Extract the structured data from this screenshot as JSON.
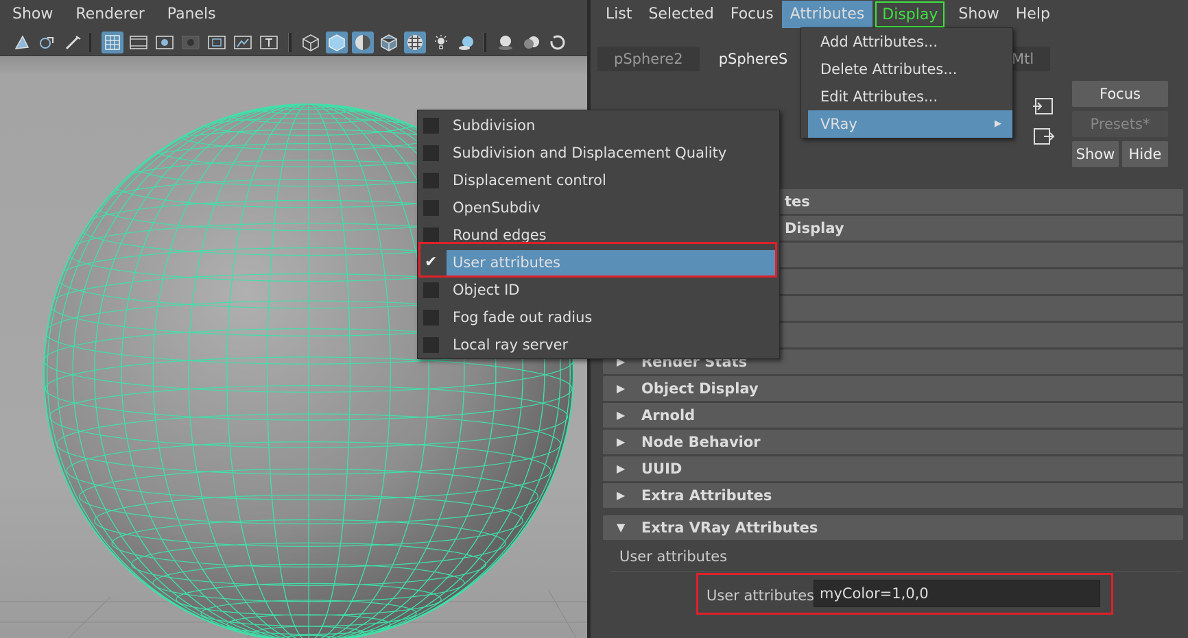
{
  "viewport": {
    "menu": [
      "Show",
      "Renderer",
      "Panels"
    ]
  },
  "attribute_editor": {
    "menu": [
      "List",
      "Selected",
      "Focus",
      "Attributes",
      "Display",
      "Show",
      "Help"
    ],
    "tabs": [
      "pSphere2",
      "pSphereS",
      "Mtl"
    ],
    "buttons": {
      "focus": "Focus",
      "presets": "Presets*",
      "show": "Show",
      "hide": "Hide"
    },
    "partial_sections": [
      "tes",
      "Display"
    ],
    "sections": [
      "Render Stats",
      "Object Display",
      "Arnold",
      "Node Behavior",
      "UUID",
      "Extra Attributes"
    ],
    "open_section": "Extra VRay Attributes",
    "user_attributes_group": "User attributes",
    "user_attributes_field_label": "User attributes",
    "user_attributes_value": "myColor=1,0,0"
  },
  "attributes_menu": {
    "items": [
      "Add Attributes...",
      "Delete Attributes...",
      "Edit Attributes...",
      "VRay"
    ]
  },
  "vray_submenu": {
    "items": [
      {
        "label": "Subdivision",
        "checked": false
      },
      {
        "label": "Subdivision and Displacement Quality",
        "checked": false
      },
      {
        "label": "Displacement control",
        "checked": false
      },
      {
        "label": "OpenSubdiv",
        "checked": false
      },
      {
        "label": "Round edges",
        "checked": false
      },
      {
        "label": "User attributes",
        "checked": true
      },
      {
        "label": "Object ID",
        "checked": false
      },
      {
        "label": "Fog fade out radius",
        "checked": false
      },
      {
        "label": "Local ray server",
        "checked": false
      }
    ]
  },
  "colors": {
    "highlight": "#5a8fb8",
    "wireframe": "#3fe0a8",
    "red_box": "#e0202a",
    "display_box": "#3fe03f"
  }
}
